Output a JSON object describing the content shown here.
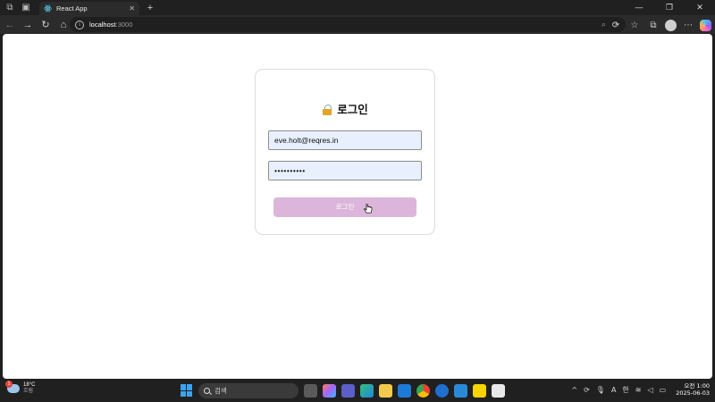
{
  "browser": {
    "tab_title": "React App",
    "address": {
      "host": "localhost",
      "port": ":3000"
    },
    "colors": {
      "chrome": "#202020",
      "toolbar": "#2b2b2b"
    }
  },
  "login": {
    "heading": "로그인",
    "email_value": "eve.holt@reqres.in",
    "password_value": "••••••••••",
    "submit_label": "로그인",
    "colors": {
      "field_bg": "#e8f0fe",
      "button_bg": "#dbb6da"
    }
  },
  "taskbar": {
    "weather": {
      "temp": "18°C",
      "condition": "흐림",
      "badge": "1"
    },
    "search_placeholder": "검색",
    "tray": {
      "ime_a": "A",
      "ime_lang": "한"
    },
    "clock": {
      "time": "오전 1:00",
      "date": "2025-06-03"
    }
  }
}
